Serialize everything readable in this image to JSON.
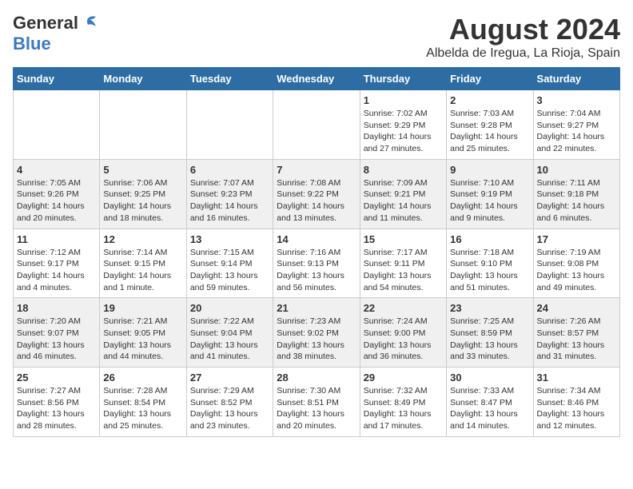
{
  "header": {
    "logo_general": "General",
    "logo_blue": "Blue",
    "month_year": "August 2024",
    "location": "Albelda de Iregua, La Rioja, Spain"
  },
  "days_of_week": [
    "Sunday",
    "Monday",
    "Tuesday",
    "Wednesday",
    "Thursday",
    "Friday",
    "Saturday"
  ],
  "weeks": [
    {
      "days": [
        {
          "num": "",
          "info": ""
        },
        {
          "num": "",
          "info": ""
        },
        {
          "num": "",
          "info": ""
        },
        {
          "num": "",
          "info": ""
        },
        {
          "num": "1",
          "info": "Sunrise: 7:02 AM\nSunset: 9:29 PM\nDaylight: 14 hours and 27 minutes."
        },
        {
          "num": "2",
          "info": "Sunrise: 7:03 AM\nSunset: 9:28 PM\nDaylight: 14 hours and 25 minutes."
        },
        {
          "num": "3",
          "info": "Sunrise: 7:04 AM\nSunset: 9:27 PM\nDaylight: 14 hours and 22 minutes."
        }
      ]
    },
    {
      "days": [
        {
          "num": "4",
          "info": "Sunrise: 7:05 AM\nSunset: 9:26 PM\nDaylight: 14 hours and 20 minutes."
        },
        {
          "num": "5",
          "info": "Sunrise: 7:06 AM\nSunset: 9:25 PM\nDaylight: 14 hours and 18 minutes."
        },
        {
          "num": "6",
          "info": "Sunrise: 7:07 AM\nSunset: 9:23 PM\nDaylight: 14 hours and 16 minutes."
        },
        {
          "num": "7",
          "info": "Sunrise: 7:08 AM\nSunset: 9:22 PM\nDaylight: 14 hours and 13 minutes."
        },
        {
          "num": "8",
          "info": "Sunrise: 7:09 AM\nSunset: 9:21 PM\nDaylight: 14 hours and 11 minutes."
        },
        {
          "num": "9",
          "info": "Sunrise: 7:10 AM\nSunset: 9:19 PM\nDaylight: 14 hours and 9 minutes."
        },
        {
          "num": "10",
          "info": "Sunrise: 7:11 AM\nSunset: 9:18 PM\nDaylight: 14 hours and 6 minutes."
        }
      ]
    },
    {
      "days": [
        {
          "num": "11",
          "info": "Sunrise: 7:12 AM\nSunset: 9:17 PM\nDaylight: 14 hours and 4 minutes."
        },
        {
          "num": "12",
          "info": "Sunrise: 7:14 AM\nSunset: 9:15 PM\nDaylight: 14 hours and 1 minute."
        },
        {
          "num": "13",
          "info": "Sunrise: 7:15 AM\nSunset: 9:14 PM\nDaylight: 13 hours and 59 minutes."
        },
        {
          "num": "14",
          "info": "Sunrise: 7:16 AM\nSunset: 9:13 PM\nDaylight: 13 hours and 56 minutes."
        },
        {
          "num": "15",
          "info": "Sunrise: 7:17 AM\nSunset: 9:11 PM\nDaylight: 13 hours and 54 minutes."
        },
        {
          "num": "16",
          "info": "Sunrise: 7:18 AM\nSunset: 9:10 PM\nDaylight: 13 hours and 51 minutes."
        },
        {
          "num": "17",
          "info": "Sunrise: 7:19 AM\nSunset: 9:08 PM\nDaylight: 13 hours and 49 minutes."
        }
      ]
    },
    {
      "days": [
        {
          "num": "18",
          "info": "Sunrise: 7:20 AM\nSunset: 9:07 PM\nDaylight: 13 hours and 46 minutes."
        },
        {
          "num": "19",
          "info": "Sunrise: 7:21 AM\nSunset: 9:05 PM\nDaylight: 13 hours and 44 minutes."
        },
        {
          "num": "20",
          "info": "Sunrise: 7:22 AM\nSunset: 9:04 PM\nDaylight: 13 hours and 41 minutes."
        },
        {
          "num": "21",
          "info": "Sunrise: 7:23 AM\nSunset: 9:02 PM\nDaylight: 13 hours and 38 minutes."
        },
        {
          "num": "22",
          "info": "Sunrise: 7:24 AM\nSunset: 9:00 PM\nDaylight: 13 hours and 36 minutes."
        },
        {
          "num": "23",
          "info": "Sunrise: 7:25 AM\nSunset: 8:59 PM\nDaylight: 13 hours and 33 minutes."
        },
        {
          "num": "24",
          "info": "Sunrise: 7:26 AM\nSunset: 8:57 PM\nDaylight: 13 hours and 31 minutes."
        }
      ]
    },
    {
      "days": [
        {
          "num": "25",
          "info": "Sunrise: 7:27 AM\nSunset: 8:56 PM\nDaylight: 13 hours and 28 minutes."
        },
        {
          "num": "26",
          "info": "Sunrise: 7:28 AM\nSunset: 8:54 PM\nDaylight: 13 hours and 25 minutes."
        },
        {
          "num": "27",
          "info": "Sunrise: 7:29 AM\nSunset: 8:52 PM\nDaylight: 13 hours and 23 minutes."
        },
        {
          "num": "28",
          "info": "Sunrise: 7:30 AM\nSunset: 8:51 PM\nDaylight: 13 hours and 20 minutes."
        },
        {
          "num": "29",
          "info": "Sunrise: 7:32 AM\nSunset: 8:49 PM\nDaylight: 13 hours and 17 minutes."
        },
        {
          "num": "30",
          "info": "Sunrise: 7:33 AM\nSunset: 8:47 PM\nDaylight: 13 hours and 14 minutes."
        },
        {
          "num": "31",
          "info": "Sunrise: 7:34 AM\nSunset: 8:46 PM\nDaylight: 13 hours and 12 minutes."
        }
      ]
    }
  ]
}
